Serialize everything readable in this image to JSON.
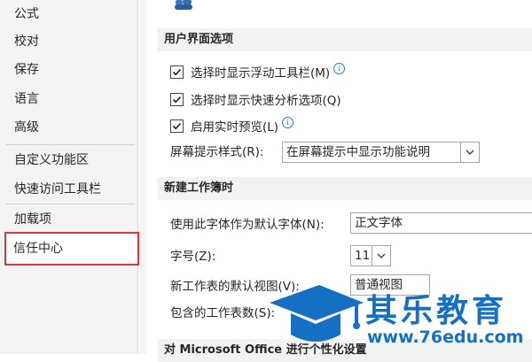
{
  "sidebar": {
    "items": [
      {
        "label": "公式"
      },
      {
        "label": "校对"
      },
      {
        "label": "保存"
      },
      {
        "label": "语言"
      },
      {
        "label": "高级"
      },
      {
        "label": "自定义功能区"
      },
      {
        "label": "快速访问工具栏"
      },
      {
        "label": "加载项"
      },
      {
        "label": "信任中心"
      }
    ],
    "active_index": 8
  },
  "ui_options": {
    "header": "用户界面选项",
    "checkboxes": [
      {
        "label": "选择时显示浮动工具栏(M)",
        "checked": true,
        "info": true
      },
      {
        "label": "选择时显示快速分析选项(Q)",
        "checked": true,
        "info": false
      },
      {
        "label": "启用实时预览(L)",
        "checked": true,
        "info": true
      }
    ],
    "screentip_label": "屏幕提示样式(R):",
    "screentip_value": "在屏幕提示中显示功能说明"
  },
  "new_workbook": {
    "header": "新建工作簿时",
    "font_label": "使用此字体作为默认字体(N):",
    "font_value": "正文字体",
    "size_label": "字号(Z):",
    "size_value": "11",
    "view_label": "新工作表的默认视图(V):",
    "view_value": "普通视图",
    "sheets_label": "包含的工作表数(S):"
  },
  "next_section": {
    "header": "对 Microsoft Office 进行个性化设置"
  },
  "watermark": {
    "brand": "其乐教育",
    "url": "www.76edu.com",
    "color": "#1570c4"
  }
}
